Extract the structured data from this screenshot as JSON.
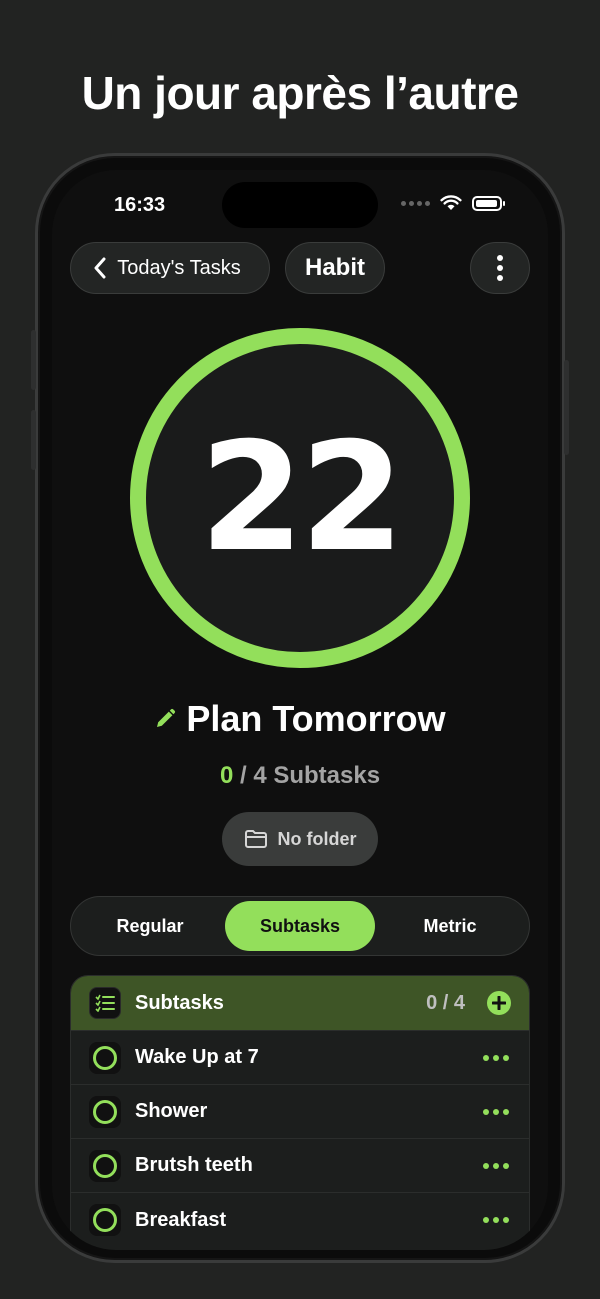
{
  "headline": "Un jour après l’autre",
  "status_bar": {
    "time": "16:33"
  },
  "nav": {
    "back_label": "Today's Tasks",
    "habit_label": "Habit"
  },
  "counter": {
    "value": "22",
    "ring_color": "#93df5b"
  },
  "task": {
    "title": "Plan Tomorrow",
    "completed": "0",
    "progress_rest": " / 4 Subtasks",
    "folder_label": "No folder"
  },
  "segments": [
    {
      "label": "Regular",
      "active": false
    },
    {
      "label": "Subtasks",
      "active": true
    },
    {
      "label": "Metric",
      "active": false
    }
  ],
  "subtasks": {
    "header_title": "Subtasks",
    "header_count": "0 / 4",
    "items": [
      {
        "label": "Wake Up at 7"
      },
      {
        "label": "Shower"
      },
      {
        "label": "Brutsh teeth"
      },
      {
        "label": "Breakfast"
      }
    ]
  },
  "colors": {
    "accent": "#93df5b",
    "header_bg": "#3e5526",
    "background": "#222322"
  }
}
